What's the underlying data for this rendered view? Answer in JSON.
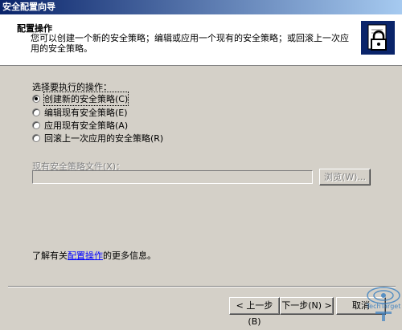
{
  "window": {
    "title": "安全配置向导"
  },
  "header": {
    "title": "配置操作",
    "description": "您可以创建一个新的安全策略；编辑或应用一个现有的安全策略；或回滚上一次应用的安全策略。",
    "icon": "lock-document-icon"
  },
  "body": {
    "prompt": "选择要执行的操作：",
    "options": [
      {
        "label": "创建新的安全策略(C)",
        "checked": true
      },
      {
        "label": "编辑现有安全策略(E)",
        "checked": false
      },
      {
        "label": "应用现有安全策略(A)",
        "checked": false
      },
      {
        "label": "回滚上一次应用的安全策略(R)",
        "checked": false
      }
    ],
    "file_label": "现有安全策略文件(X)：",
    "file_value": "",
    "browse_label": "浏览(W)..."
  },
  "info": {
    "prefix": "了解有关",
    "link": "配置操作",
    "suffix": "的更多信息。"
  },
  "footer": {
    "back_label": "< 上一步(B)",
    "next_label": "下一步(N) >",
    "cancel_label": "取消"
  },
  "watermark": {
    "text": "TechTarget"
  },
  "colors": {
    "titlebar_start": "#0a246a",
    "titlebar_end": "#a6caf0",
    "link": "#0000ff",
    "face": "#d4d0c8"
  }
}
